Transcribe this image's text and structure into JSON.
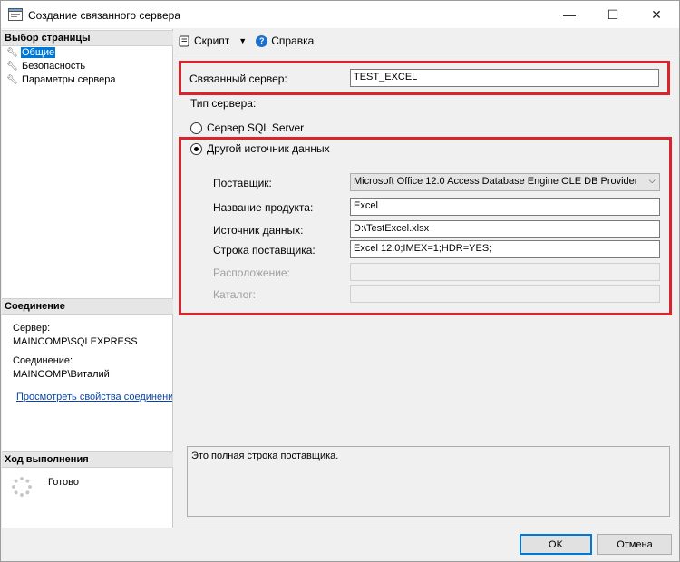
{
  "window": {
    "title": "Создание связанного сервера",
    "min_glyph": "—",
    "max_glyph": "☐",
    "close_glyph": "✕"
  },
  "left_panel": {
    "select_page_header": "Выбор страницы",
    "pages": [
      {
        "label": "Общие",
        "selected": true
      },
      {
        "label": "Безопасность",
        "selected": false
      },
      {
        "label": "Параметры сервера",
        "selected": false
      }
    ],
    "connection_header": "Соединение",
    "server_label": "Сервер:",
    "server_value": "MAINCOMP\\SQLEXPRESS",
    "connection_label": "Соединение:",
    "connection_value": "MAINCOMP\\Виталий",
    "view_props_link": "Просмотреть свойства соединения",
    "progress_header": "Ход выполнения",
    "progress_status": "Готово"
  },
  "toolbar": {
    "script_label": "Скрипт",
    "help_label": "Справка"
  },
  "form": {
    "linked_server_label": "Связанный сервер:",
    "linked_server_value": "TEST_EXCEL",
    "server_type_label": "Тип сервера:",
    "radio_sql_label": "Сервер SQL Server",
    "radio_other_label": "Другой источник данных",
    "provider_label": "Поставщик:",
    "provider_value": "Microsoft Office 12.0 Access Database Engine OLE DB Provider",
    "product_name_label": "Название продукта:",
    "product_name_value": "Excel",
    "data_source_label": "Источник данных:",
    "data_source_value": "D:\\TestExcel.xlsx",
    "provider_string_label": "Строка поставщика:",
    "provider_string_value": "Excel 12.0;IMEX=1;HDR=YES;",
    "location_label": "Расположение:",
    "location_value": "",
    "catalog_label": "Каталог:",
    "catalog_value": "",
    "description": "Это полная строка поставщика."
  },
  "buttons": {
    "ok": "OK",
    "cancel": "Отмена"
  },
  "colors": {
    "highlight_border": "#d9232d",
    "selection": "#0078d7",
    "link": "#0645ad"
  }
}
